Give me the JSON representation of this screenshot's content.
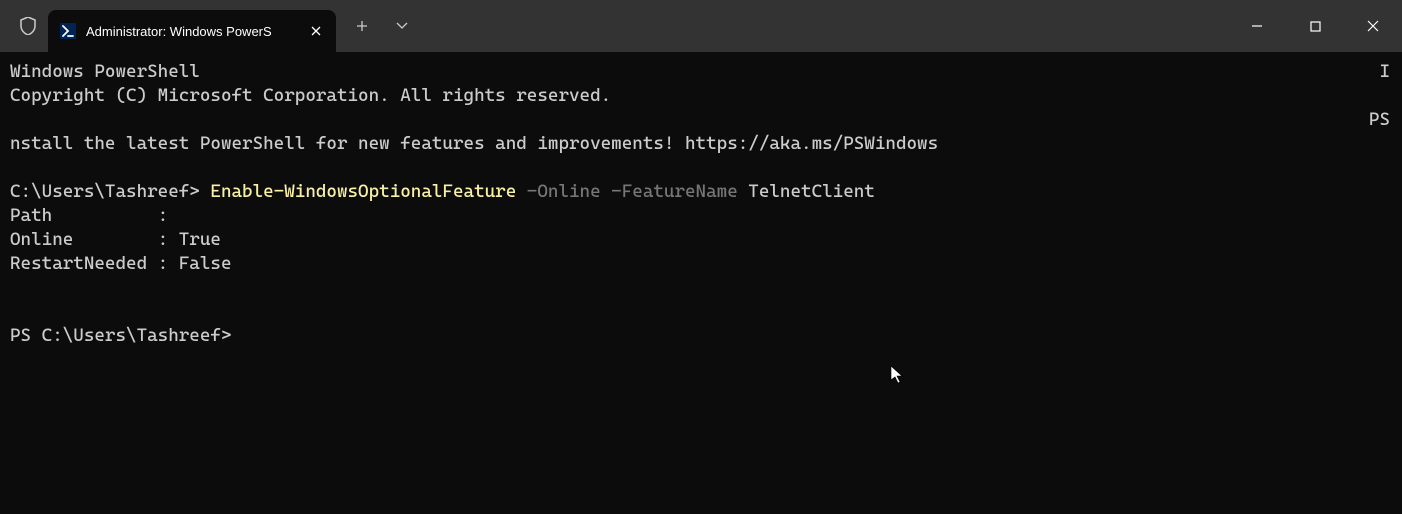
{
  "titlebar": {
    "tab_title": "Administrator: Windows PowerS",
    "add_tab_glyph": "+",
    "dropdown_glyph": "⌄"
  },
  "window_controls": {
    "minimize": "minimize",
    "maximize": "maximize",
    "close": "close"
  },
  "terminal": {
    "line1": "Windows PowerShell",
    "line2": "Copyright (C) Microsoft Corporation. All rights reserved.",
    "blank1": "",
    "line3": "nstall the latest PowerShell for new features and improvements! https://aka.ms/PSWindows",
    "blank2": "",
    "prompt1_prefix": "C:\\Users\\Tashreef> ",
    "cmdlet": "Enable-WindowsOptionalFeature",
    "param1": " -Online",
    "param2": " -FeatureName",
    "arg": " TelnetClient",
    "result_path": "Path          :",
    "result_online": "Online        : True",
    "result_restart": "RestartNeeded : False",
    "blank3": "",
    "blank4": "",
    "prompt2": "PS C:\\Users\\Tashreef>"
  },
  "right_fragments": {
    "line1": "I",
    "line2": "",
    "line3": "PS"
  }
}
